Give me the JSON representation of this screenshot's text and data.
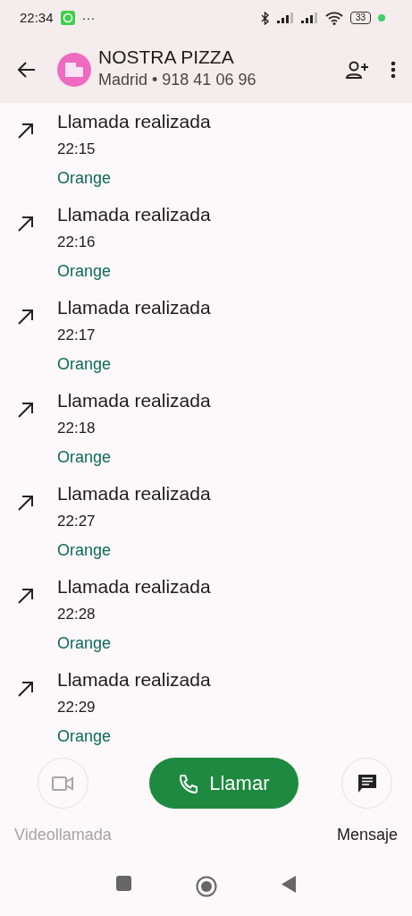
{
  "status_bar": {
    "time": "22:34",
    "more": "···",
    "battery": "33"
  },
  "header": {
    "title": "NOSTRA PIZZA",
    "subtitle": "Madrid • 918 41 06 96"
  },
  "calls": [
    {
      "title": "Llamada realizada",
      "time": "22:15",
      "carrier": "Orange"
    },
    {
      "title": "Llamada realizada",
      "time": "22:16",
      "carrier": "Orange"
    },
    {
      "title": "Llamada realizada",
      "time": "22:17",
      "carrier": "Orange"
    },
    {
      "title": "Llamada realizada",
      "time": "22:18",
      "carrier": "Orange"
    },
    {
      "title": "Llamada realizada",
      "time": "22:27",
      "carrier": "Orange"
    },
    {
      "title": "Llamada realizada",
      "time": "22:28",
      "carrier": "Orange"
    },
    {
      "title": "Llamada realizada",
      "time": "22:29",
      "carrier": "Orange"
    }
  ],
  "actions": [
    {
      "kind": "video",
      "label": "Videollamada",
      "disabled": true
    },
    {
      "kind": "call",
      "label": "Llamar",
      "disabled": false
    },
    {
      "kind": "message",
      "label": "Mensaje",
      "disabled": false
    }
  ]
}
